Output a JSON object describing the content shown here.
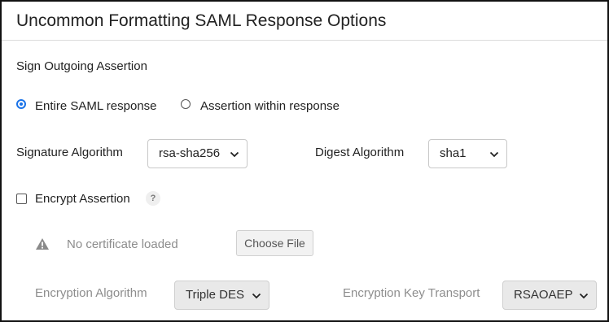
{
  "title": "Uncommon Formatting SAML Response Options",
  "sign_outgoing": {
    "label": "Sign Outgoing Assertion",
    "options": [
      {
        "label": "Entire SAML response",
        "selected": true
      },
      {
        "label": "Assertion within response",
        "selected": false
      }
    ]
  },
  "signature_algorithm": {
    "label": "Signature Algorithm",
    "value": "rsa-sha256"
  },
  "digest_algorithm": {
    "label": "Digest Algorithm",
    "value": "sha1"
  },
  "encrypt_assertion": {
    "label": "Encrypt Assertion",
    "checked": false,
    "help_icon": "?"
  },
  "certificate": {
    "icon": "warning-icon",
    "status": "No certificate loaded",
    "button_label": "Choose File"
  },
  "encryption_algorithm": {
    "label": "Encryption Algorithm",
    "value": "Triple DES",
    "disabled": true
  },
  "encryption_key_transport": {
    "label": "Encryption Key Transport",
    "value": "RSAOAEP",
    "disabled": true
  },
  "colors": {
    "accent": "#1a73e8",
    "muted_text": "#8d8d8d",
    "disabled_bg": "#e9e9e9"
  }
}
